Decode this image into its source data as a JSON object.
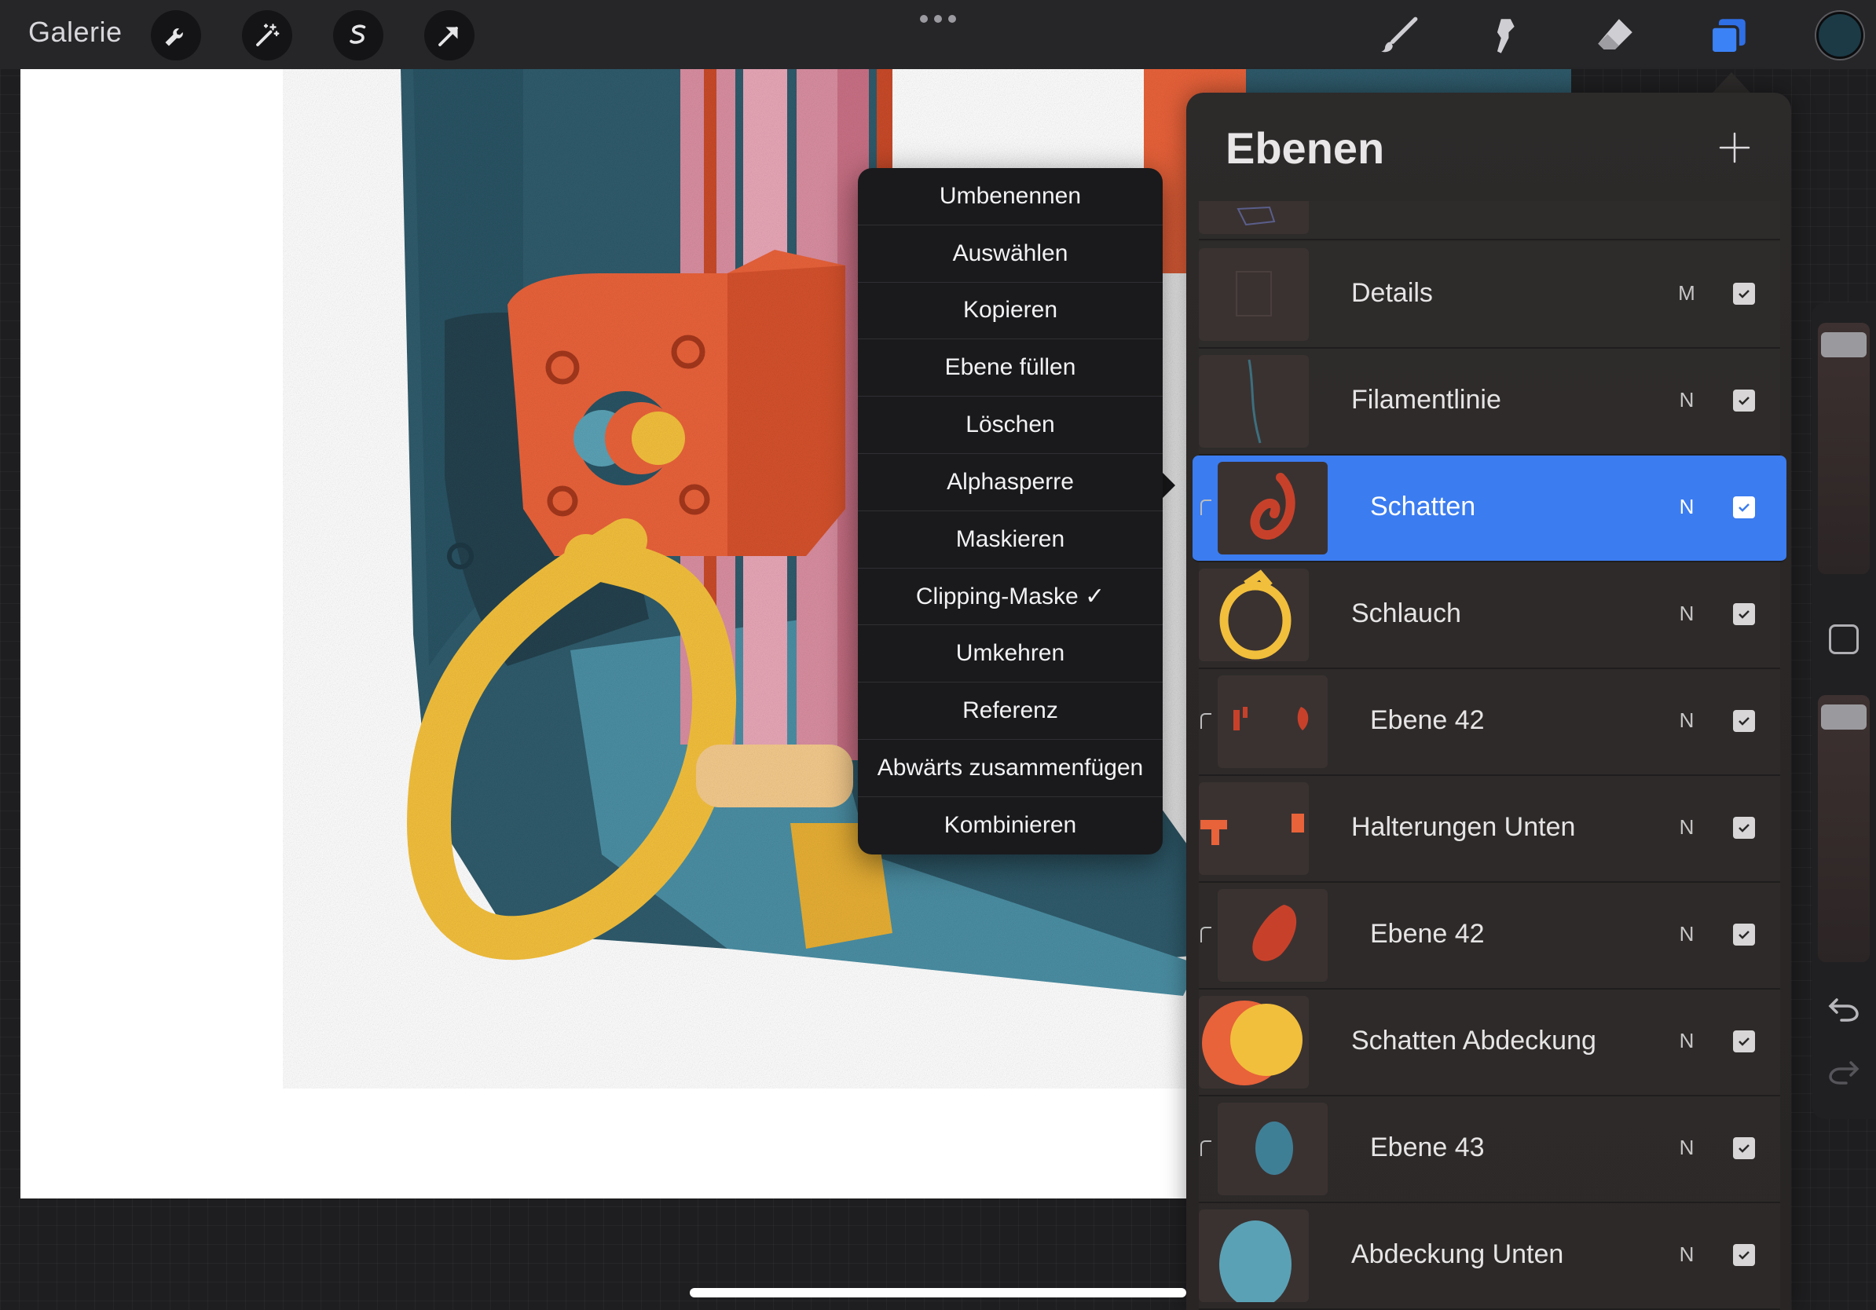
{
  "toolbar": {
    "gallery_label": "Galerie",
    "left_tools": [
      "wrench-icon",
      "magic-wand-icon",
      "selection-icon",
      "transform-arrow-icon"
    ],
    "right_tools": [
      "brush-icon",
      "smudge-icon",
      "eraser-icon",
      "layers-icon"
    ],
    "active_right_tool": "layers-icon",
    "current_color": "#1b3a46"
  },
  "context_menu": {
    "items": [
      "Umbenennen",
      "Auswählen",
      "Kopieren",
      "Ebene füllen",
      "Löschen",
      "Alphasperre",
      "Maskieren",
      "Clipping-Maske ✓",
      "Umkehren",
      "Referenz",
      "Abwärts zusammenfügen",
      "Kombinieren"
    ]
  },
  "layers_panel": {
    "title": "Ebenen",
    "layers": [
      {
        "name": "Details",
        "mode": "M",
        "visible": true,
        "clipped": false,
        "selected": false
      },
      {
        "name": "Filamentlinie",
        "mode": "N",
        "visible": true,
        "clipped": false,
        "selected": false
      },
      {
        "name": "Schatten",
        "mode": "N",
        "visible": true,
        "clipped": true,
        "selected": true
      },
      {
        "name": "Schlauch",
        "mode": "N",
        "visible": true,
        "clipped": false,
        "selected": false
      },
      {
        "name": "Ebene 42",
        "mode": "N",
        "visible": true,
        "clipped": true,
        "selected": false
      },
      {
        "name": "Halterungen Unten",
        "mode": "N",
        "visible": true,
        "clipped": false,
        "selected": false
      },
      {
        "name": "Ebene 42",
        "mode": "N",
        "visible": true,
        "clipped": true,
        "selected": false
      },
      {
        "name": "Schatten Abdeckung",
        "mode": "N",
        "visible": true,
        "clipped": false,
        "selected": false
      },
      {
        "name": "Ebene 43",
        "mode": "N",
        "visible": true,
        "clipped": true,
        "selected": false
      },
      {
        "name": "Abdeckung Unten",
        "mode": "N",
        "visible": true,
        "clipped": false,
        "selected": false
      }
    ]
  },
  "colors": {
    "selection_blue": "#3b7cf0",
    "art_teal": "#2f5b6b",
    "art_orange": "#e8623a",
    "art_yellow": "#f2bf3c",
    "art_pink": "#d88ea0"
  }
}
